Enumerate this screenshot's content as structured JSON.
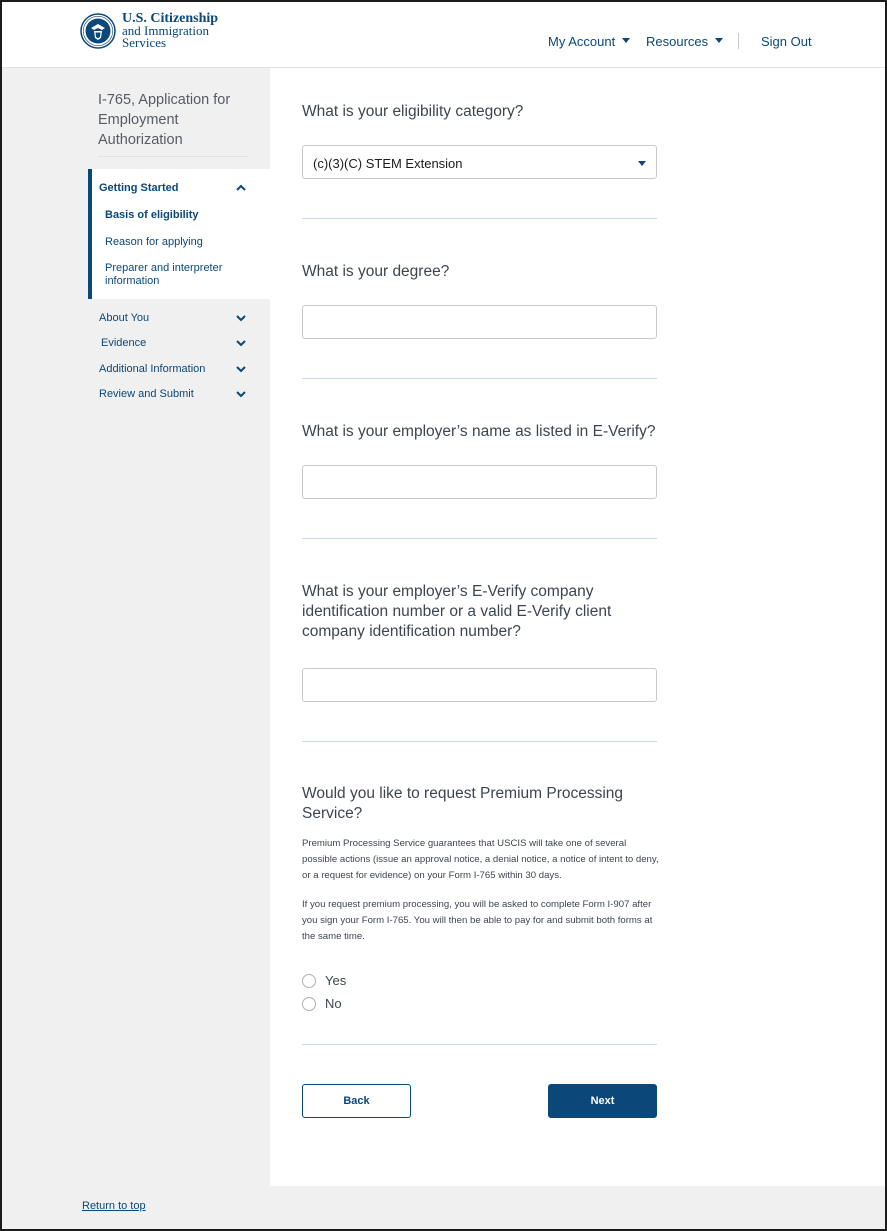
{
  "header": {
    "logo_lines": [
      "U.S. Citizenship",
      "and Immigration",
      "Services"
    ],
    "nav": {
      "my_account": "My Account",
      "resources": "Resources",
      "sign_out": "Sign Out"
    }
  },
  "sidebar": {
    "title": "I-765, Application for Employment Authorization",
    "sections": [
      {
        "label": "Getting Started",
        "expanded": true,
        "icon": "chevron-up-icon"
      },
      {
        "label": "About You",
        "expanded": false,
        "icon": "chevron-down-icon"
      },
      {
        "label": "Evidence",
        "expanded": false,
        "icon": "chevron-down-icon"
      },
      {
        "label": "Additional Information",
        "expanded": false,
        "icon": "chevron-down-icon"
      },
      {
        "label": "Review and Submit",
        "expanded": false,
        "icon": "chevron-down-icon"
      }
    ],
    "sub_items": [
      {
        "label": "Basis of eligibility",
        "current": true
      },
      {
        "label": "Reason for applying",
        "current": false
      },
      {
        "label": "Preparer and interpreter information",
        "current": false
      }
    ]
  },
  "main": {
    "q_eligibility": "What is your eligibility category?",
    "eligibility_value": "(c)(3)(C) STEM Extension",
    "q_degree": "What is your degree?",
    "q_employer_name": "What is your employer’s name as listed in E-Verify?",
    "q_employer_id": "What is your employer’s E-Verify company identification number or a valid E-Verify client company identification number?",
    "q_premium": "Would you like to request Premium Processing Service?",
    "premium_para1": "Premium Processing Service guarantees that USCIS will take one of several possible actions (issue an approval notice, a denial notice, a notice of intent to deny, or a request for evidence) on your Form I-765 within 30 days.",
    "premium_para2": "If you request premium processing, you will be asked to complete Form I-907 after you sign your Form I-765. You will then be able to pay for and submit both forms at the same time.",
    "radio_yes": "Yes",
    "radio_no": "No",
    "back_label": "Back",
    "next_label": "Next"
  },
  "footer": {
    "return_to_top": "Return to top"
  },
  "colors": {
    "brand": "#0b4778",
    "sidebar_bg": "#f0f0f0",
    "separator": "#c8dbe8"
  }
}
